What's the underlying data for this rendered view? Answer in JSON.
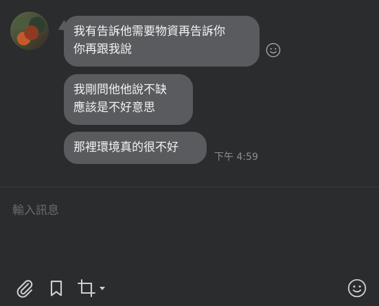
{
  "chat": {
    "messages": [
      {
        "text": "我有告訴他需要物資再告訴你\n你再跟我說"
      },
      {
        "text": "我剛問他他說不缺\n應該是不好意思"
      },
      {
        "text": "那裡環境真的很不好"
      }
    ],
    "timestamp": "下午 4:59"
  },
  "composer": {
    "placeholder": "輸入訊息"
  },
  "icons": {
    "reaction": "emoji-icon",
    "attach": "paperclip-icon",
    "bookmark": "bookmark-icon",
    "crop": "crop-icon",
    "emoji": "emoji-icon"
  },
  "colors": {
    "background": "#2b2c2e",
    "bubble": "#5a5b5e"
  }
}
